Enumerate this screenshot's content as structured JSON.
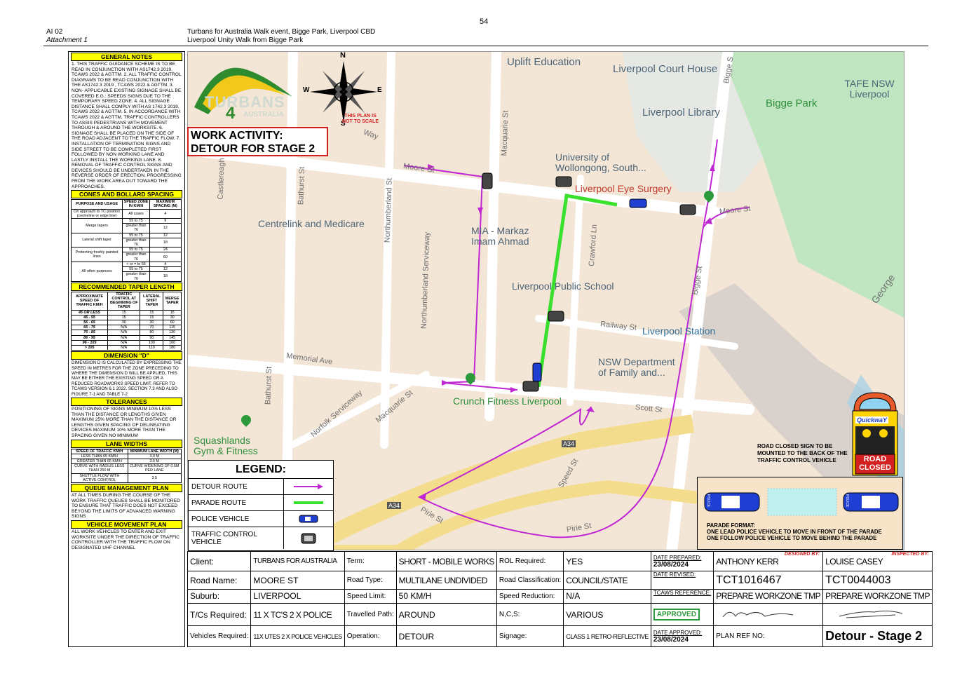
{
  "header": {
    "page_number": "54",
    "item": "AI 02",
    "attachment": "Attachment 1",
    "event_line1": "Turbans for Australia Walk event, Bigge Park, Liverpool CBD",
    "event_line2": "Liverpool Unity Walk from Bigge Park"
  },
  "notes": {
    "general_title": "GENERAL NOTES",
    "general_text": "1. THIS TRAFFIC GUIDANCE SCHEME IS TO BE READ IN CONJUNCTION WITH AS1742.3 2019, TCAWS 2022 & AGTTM. 2. ALL TRAFFIC CONTROL DIAGRAMS TO BE READ CONJUNCTION WITH THE AS1742.3 2019 , TCAWS 2022 & AGTTM. 3. NON- APPLICABLE EXISTING SIGNAGE SHALL BE COVERED E.G.: SPEEDS SIGNS DUE TO THE TEMPORARY SPEED ZONE. 4. ALL SIGNAGE DISTANCE SHALL COMPLY WITH AS 1742.3 2019, TCAWS 2022 & AGTTM. 5. IN ACCORDANCE WITH TCAWS 2022 & AGTTM, TRAFFIC CONTROLLERS TO ASSIS PEDESTRIANS WITH MOVEMENT THROUGH & AROUND THE WORKSITE. 6. SIGNAGE SHALL BE PLACED ON THE SIDE OF THE ROAD ADJACENT TO THE TRAFFIC FLOW. 7. INSTALLATION OF TERMINATION SIGNS AND SIDE STREET TO BE COMPLETED FIRST FOLLOWED BY NON WORKING LANE AND LASTLY INSTALL THE WORKING LANE. 8. REMOVAL OF TRAFFIC CONTROL SIGNS AND DEVICES SHOULD BE UNDERTAKEN IN THE REVERSE ORDER OF ERECTION, PROGRESSING FROM THE WORK AREA OUT TOWARD THE APPROACHES.",
    "cones_title": "CONES AND BOLLARD SPACING",
    "cones_headers": [
      "PURPOSE AND USAGE",
      "SPEED ZONE IN KM/H",
      "MAXIMUM SPACING (M)"
    ],
    "cones_rows": [
      [
        "On approach to TC position (centreline or edge line)",
        "All cases",
        "4"
      ],
      [
        "Merge tapers",
        "55 to 75",
        "9"
      ],
      [
        "",
        "greater than 76",
        "12"
      ],
      [
        "Lateral shift taper",
        "55 to 75",
        "12"
      ],
      [
        "",
        "greater than 76",
        "18"
      ],
      [
        "Protecting freshly painted lines",
        "55 to 75",
        "24"
      ],
      [
        "",
        "greater than 76",
        "60"
      ],
      [
        "All other purposes",
        "< or = to 55",
        "4"
      ],
      [
        "",
        "55 to 75",
        "12"
      ],
      [
        "",
        "greater than 76",
        "18"
      ]
    ],
    "taper_title": "RECOMMENDED TAPER LENGTH",
    "taper_headers": [
      "APPROXIMATE SPEED OF TRAFFIC KM/H",
      "TRAFFIC CONTROL AT BEGINNING OF TAPER",
      "LATERAL SHIFT TAPER",
      "MERGE TAPER"
    ],
    "taper_rows": [
      [
        "45 OR LESS",
        "15",
        "15",
        "15"
      ],
      [
        "46 - 55",
        "15",
        "15",
        "30"
      ],
      [
        "56 - 65",
        "30",
        "30",
        "60"
      ],
      [
        "66 - 75",
        "N/A",
        "70",
        "115"
      ],
      [
        "76 - 85",
        "N/A",
        "80",
        "130"
      ],
      [
        "86 - 95",
        "N/A",
        "90",
        "145"
      ],
      [
        "96 - 105",
        "N/A",
        "100",
        "160"
      ],
      [
        "> 105",
        "N/A",
        "110",
        "180"
      ]
    ],
    "dimension_title": "DIMENSION \"D\"",
    "dimension_text": "DIMENSION D IS CALCULATED BY EXPRESSING THE SPEED IN METRES FOR THE ZONE PRECEDING TO WHERE THE DIMENSION D WILL BE APPLIED, THIS MAY BE EITHER THE EXISTING SPEED OR A REDUCED ROADWORKS SPEED LIMIT. REFER TO TCAWS VERSION 6.1 2022. SECTION 7.3 AND ALSO FIGURE 7-1 AND TABLE 7-2",
    "tolerances_title": "TOLERANCES",
    "tolerances_text": "POSITIONING OF SIGNS MINIMUM 10% LESS THAN THE DISTANCE OR LENGTHS GIVEN MAXIMUM 25% MORE THAN THE DISTANCE OR LENGTHS GIVEN SPACING OF DELINEATING DEVICES MAXIMUM 10% MORE THAN THE SPACING GIVEN NO MINIMUM",
    "lane_title": "LANE WIDTHS",
    "lane_headers": [
      "SPEED OF TRAFFIC KM/H",
      "MINIMUM LANE WIDTH (M)"
    ],
    "lane_rows": [
      [
        "LESS THAN 65 KM/H",
        "3.0 M"
      ],
      [
        "GREATER THAN 65 KM/H",
        "3.5 M"
      ],
      [
        "CURVE WITH RADIUS LESS THAN 250 M",
        "CURVE WIDENING OF 0.5M PER LANE"
      ],
      [
        "SHUTTLE FLOW WITH ACTIVE CONTROL",
        "3.5"
      ]
    ],
    "queue_title": "QUEUE MANAGEMENT PLAN",
    "queue_text": "AT ALL TIMES DURING THE COURSE OF THE WORK TRAFFIC QUEUES SHALL BE MONITORED TO ENSURE THAT TRAFFIC DOES NOT EXCEED BEYOND THE LIMITS OF ADVANCED WARNING SIGNS",
    "vehicle_title": "VEHICLE MOVEMENT PLAN",
    "vehicle_text": "ALL WORK VEHICLES TO ENTER AND EXIT WORKSITE UNDER THE DIRECTION OF TRAFFIC CONTROLLER WITH THE TRAFFIC FLOW ON DESIGNATED UHF CHANNEL"
  },
  "map": {
    "labels": {
      "uplift": "Uplift Education",
      "court": "Liverpool Court House",
      "library": "Liverpool Library",
      "bigge_park": "Bigge Park",
      "tafe": "TAFE NSW Liverpool",
      "uow": "University of Wollongong, South...",
      "eye": "Liverpool Eye Surgery",
      "centrelink": "Centrelink and Medicare",
      "mia": "MIA - Markaz Imam Ahmad",
      "school": "Liverpool Public School",
      "station": "Liverpool Station",
      "nsw": "NSW Department of Family and...",
      "crunch": "Crunch Fitness Liverpool",
      "squash": "Squashlands Gym & Fitness"
    },
    "streets": {
      "moore1": "Moore St",
      "moore2": "Moore St",
      "macquarie1": "Macquarie St",
      "macquarie2": "Macquarie St",
      "northumberland": "Northumberland St",
      "northumberland_sw": "Northumberland Serviceway",
      "bathurst1": "Bathurst St",
      "bathurst2": "Bathurst St",
      "castlereagh": "Castlereagh",
      "memorial": "Memorial Ave",
      "norfolk": "Norfolk Serviceway",
      "railway": "Railway St",
      "crawford": "Crawford Ln",
      "bigge1": "Bigge St",
      "bigge2": "Bigge S",
      "scott": "Scott St",
      "speed": "Speed St",
      "pirie1": "Pirie St",
      "pirie2": "Pirie St",
      "george": "George",
      "a34a": "A34",
      "a34b": "A34",
      "way": "Way"
    },
    "compass": {
      "n": "N",
      "s": "S",
      "e": "E",
      "w": "W"
    },
    "not_to_scale": "THIS PLAN IS NOT TO SCALE",
    "work_activity": "WORK ACTIVITY:",
    "work_detour": "DETOUR FOR STAGE 2",
    "logo_turbans": "TURBANS",
    "logo_4": "4",
    "logo_australia": "AUSTRALIA",
    "route_colors": {
      "detour": "#c026d3",
      "parade": "#39e02e"
    }
  },
  "legend": {
    "title": "LEGEND:",
    "items": [
      "DETOUR ROUTE",
      "PARADE ROUTE",
      "POLICE VEHICLE",
      "TRAFFIC CONTROL VEHICLE"
    ]
  },
  "road_closed": {
    "note": "ROAD CLOSED SIGN TO BE MOUNTED TO THE BACK OF THE TRAFFIC CONTROL VEHICLE",
    "brand": "QuickwaY",
    "sign_line1": "ROAD",
    "sign_line2": "CLOSED"
  },
  "parade": {
    "title": "PARADE FORMAT:",
    "line1": "ONE LEAD POLICE VEHICLE TO MOVE IN FRONT OF THE PARADE",
    "line2": "ONE FOLLOW POLICE VEHICLE TO MOVE BEHIND THE PARADE",
    "police_text": "POLICE"
  },
  "info": {
    "client_l": "Client:",
    "client_v": "TURBANS FOR AUSTRALIA",
    "term_l": "Term:",
    "term_v": "SHORT - MOBILE WORKS",
    "rol_l": "ROL Required:",
    "rol_v": "YES",
    "date_prep_l": "DATE PREPARED:",
    "date_prep_v": "23/08/2024",
    "designer": "ANTHONY KERR",
    "designed_by": "DESIGNED BY:",
    "inspector": "LOUISE CASEY",
    "inspected_by": "INSPECTED BY:",
    "road_l": "Road Name:",
    "road_v": "MOORE ST",
    "roadtype_l": "Road Type:",
    "roadtype_v": "MULTILANE UNDIVIDED",
    "class_l": "Road Classification:",
    "class_v": "COUNCIL/STATE",
    "date_rev_l": "DATE REVISED:",
    "tct1": "TCT1016467",
    "tct2": "TCT0044003",
    "suburb_l": "Suburb:",
    "suburb_v": "LIVERPOOL",
    "speed_l": "Speed Limit:",
    "speed_v": "50 KM/H",
    "reduction_l": "Speed Reduction:",
    "reduction_v": "N/A",
    "tcaws_l": "TCAWS REFERENCE:",
    "prep1": "PREPARE WORKZONE TMP",
    "prep2": "PREPARE WORKZONE TMP",
    "tc_l": "T/Cs Required:",
    "tc_v": "11 X TC'S 2 X POLICE",
    "path_l": "Travelled Path:",
    "path_v": "AROUND",
    "ncs_l": "N,C,S:",
    "ncs_v": "VARIOUS",
    "approved": "APPROVED",
    "veh_l": "Vehicles Required:",
    "veh_v": "11X UTES 2 X POLICE VEHICLES",
    "op_l": "Operation:",
    "op_v": "DETOUR",
    "sign_l": "Signage:",
    "sign_v": "CLASS 1 RETRO-REFLECTIVE",
    "date_app_l": "DATE APPROVED:",
    "date_app_v": "23/08/2024",
    "plan_l": "PLAN REF NO:",
    "plan_v": "Detour - Stage 2"
  }
}
